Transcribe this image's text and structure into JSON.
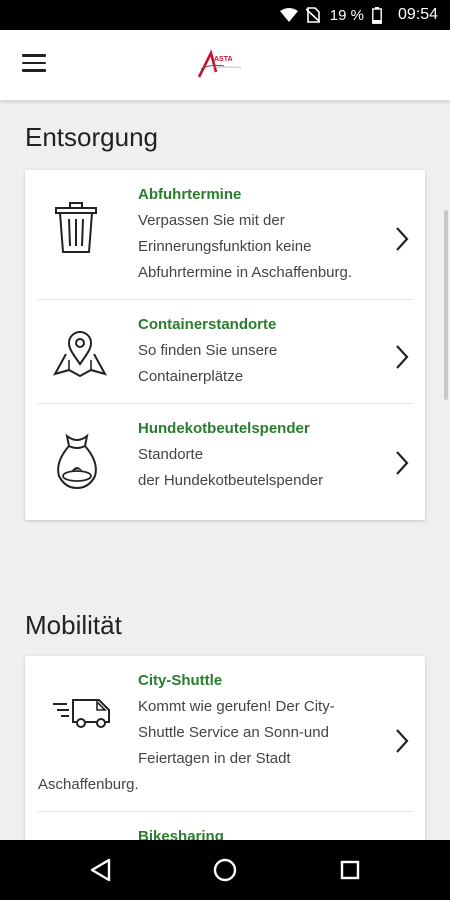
{
  "status_bar": {
    "battery_percent": "19 %",
    "time": "09:54"
  },
  "app_bar": {
    "logo_text": "ASTA",
    "logo_subtext": "Stadt Aschaffenburg"
  },
  "sections": [
    {
      "title": "Entsorgung",
      "items": [
        {
          "title": "Abfuhrtermine",
          "desc_lines": [
            "Verpassen Sie mit der",
            "Erinnerungsfunktion keine",
            "Abfuhrtermine in Aschaffenburg."
          ],
          "icon": "trash-can-icon"
        },
        {
          "title": "Containerstandorte",
          "desc_lines": [
            "So finden Sie unsere",
            "Containerplätze"
          ],
          "icon": "map-pin-icon"
        },
        {
          "title": "Hundekotbeutelspender",
          "desc_lines": [
            "Standorte",
            "der Hundekotbeutelspender"
          ],
          "icon": "dog-bag-icon"
        }
      ]
    },
    {
      "title": "Mobilität",
      "items": [
        {
          "title": "City-Shuttle",
          "desc_lines": [
            "Kommt wie gerufen! Der City-",
            "Shuttle Service an Sonn-und",
            "Feiertagen in der Stadt"
          ],
          "desc_wrap": "Aschaffenburg.",
          "icon": "shuttle-van-icon"
        },
        {
          "title": "Bikesharing",
          "icon": "bike-icon"
        }
      ]
    }
  ],
  "colors": {
    "accent_green": "#2a7d2e",
    "logo_red": "#c8102e"
  }
}
